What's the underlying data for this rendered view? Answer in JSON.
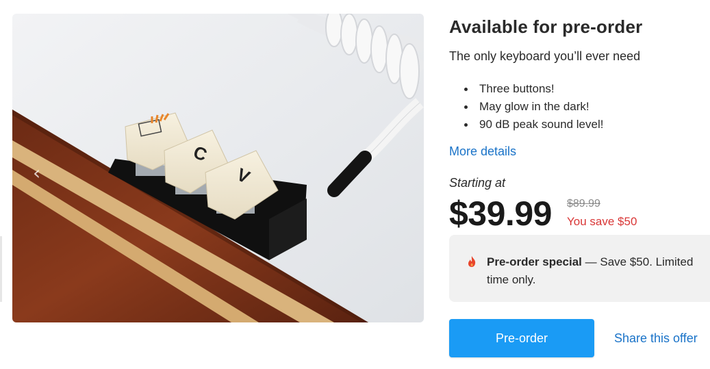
{
  "product": {
    "title": "Available for pre-order",
    "subtitle": "The only keyboard you’ll ever need",
    "features": [
      "Three buttons!",
      "May glow in the dark!",
      "90 dB peak sound level!"
    ],
    "more_details_label": "More details",
    "image": {
      "key_labels": [
        "C",
        "V"
      ],
      "carousel_prev_glyph": "‹"
    }
  },
  "pricing": {
    "starting_label": "Starting at",
    "price": "$39.99",
    "original_price": "$89.99",
    "savings": "You save $50"
  },
  "promo": {
    "icon": "flame-icon",
    "headline": "Pre-order special",
    "separator": " — ",
    "details": "Save $50. Limited time only."
  },
  "actions": {
    "preorder_label": "Pre-order",
    "share_label": "Share this offer"
  },
  "colors": {
    "accent_button": "#1a9bf5",
    "link": "#1a73c8",
    "savings": "#d93636",
    "promo_bg": "#f1f1f1",
    "flame": "#e8452c"
  }
}
